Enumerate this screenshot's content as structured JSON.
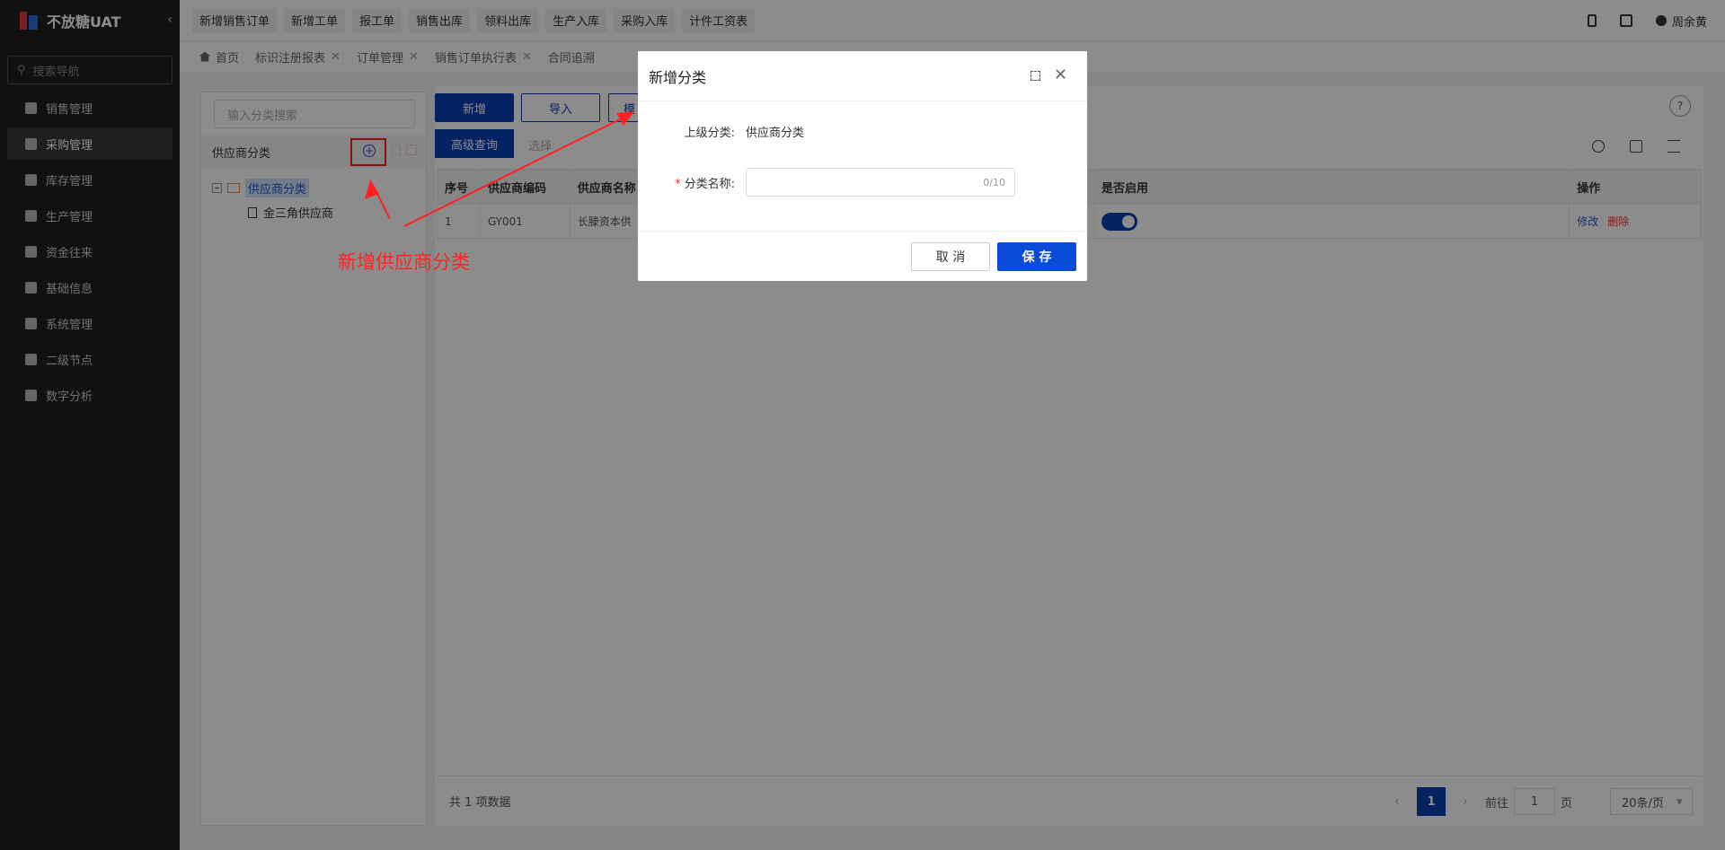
{
  "app": {
    "title": "不放糖UAT"
  },
  "sidebar": {
    "search_placeholder": "搜索导航",
    "items": [
      {
        "label": "销售管理"
      },
      {
        "label": "采购管理"
      },
      {
        "label": "库存管理"
      },
      {
        "label": "生产管理"
      },
      {
        "label": "资金往来"
      },
      {
        "label": "基础信息"
      },
      {
        "label": "系统管理"
      },
      {
        "label": "二级节点"
      },
      {
        "label": "数字分析"
      }
    ]
  },
  "topbar": {
    "quick_buttons": [
      "新增销售订单",
      "新增工单",
      "报工单",
      "销售出库",
      "领料出库",
      "生产入库",
      "采购入库",
      "计件工资表"
    ],
    "user": "周余黄"
  },
  "tabs": [
    {
      "label": "首页"
    },
    {
      "label": "标识注册报表"
    },
    {
      "label": "订单管理"
    },
    {
      "label": "销售订单执行表"
    },
    {
      "label": "合同追溯"
    }
  ],
  "left_panel": {
    "search_placeholder": "输入分类搜索",
    "header": "供应商分类",
    "tree_root": "供应商分类",
    "tree_child": "金三角供应商"
  },
  "main": {
    "btn_add": "新增",
    "btn_import": "导入",
    "btn_template": "模",
    "tab_advanced": "高级查询",
    "tab_select": "选择",
    "help": "?",
    "columns": [
      "序号",
      "供应商编码",
      "供应商名称",
      "是否启用",
      "操作"
    ],
    "rows": [
      {
        "index": "1",
        "code": "GY001",
        "name": "长滕资本供",
        "enabled": true,
        "edit": "修改",
        "delete": "删除"
      }
    ],
    "total": "共 1 项数据",
    "pager": {
      "current": "1",
      "goto_label": "前往",
      "goto_value": "1",
      "page_unit": "页",
      "page_size": "20条/页"
    }
  },
  "modal": {
    "title": "新增分类",
    "parent_label": "上级分类:",
    "parent_value": "供应商分类",
    "required_mark": "*",
    "name_label": "分类名称:",
    "name_counter": "0/10",
    "cancel": "取 消",
    "save": "保 存"
  },
  "annotation": {
    "text": "新增供应商分类",
    "color": "#ff2222"
  },
  "colors": {
    "primary": "#0a3fb4",
    "sidebar": "#1f1f1f",
    "danger": "#ee3333"
  }
}
